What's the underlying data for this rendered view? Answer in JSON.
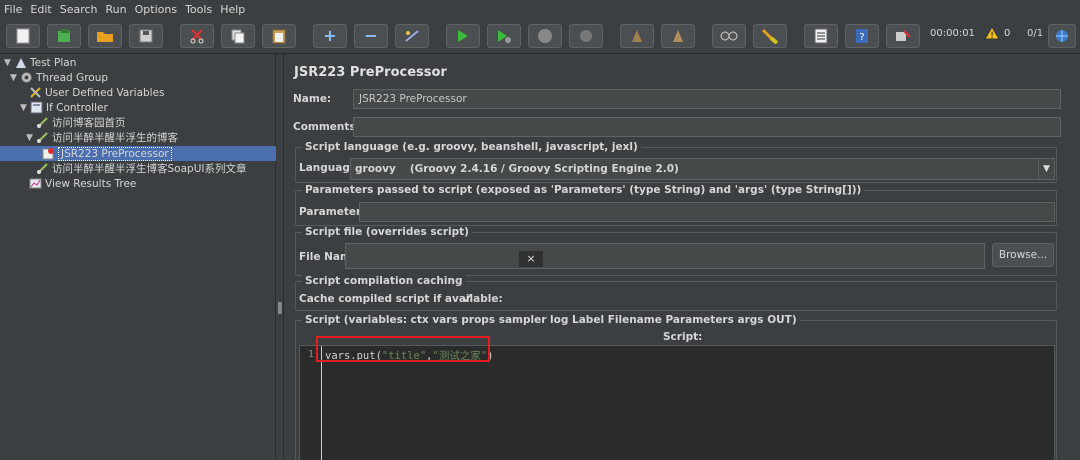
{
  "menu": [
    "File",
    "Edit",
    "Search",
    "Run",
    "Options",
    "Tools",
    "Help"
  ],
  "toolbar": {
    "timer": "00:00:01",
    "warnings": "0",
    "threads": "0/1"
  },
  "tree": [
    {
      "label": "Test Plan",
      "icon": "test-plan-icon"
    },
    {
      "label": "Thread Group",
      "icon": "gear-icon"
    },
    {
      "label": "User Defined Variables",
      "icon": "wrench-icon"
    },
    {
      "label": "If Controller",
      "icon": "controller-icon"
    },
    {
      "label": "访问博客园首页",
      "icon": "sampler-icon"
    },
    {
      "label": "访问半醉半醒半浮生的博客",
      "icon": "sampler-icon"
    },
    {
      "label": "JSR223 PreProcessor",
      "icon": "preprocessor-icon"
    },
    {
      "label": "访问半醉半醒半浮生博客SoapUI系列文章",
      "icon": "sampler-icon"
    },
    {
      "label": "View Results Tree",
      "icon": "chart-icon"
    }
  ],
  "panel": {
    "title": "JSR223 PreProcessor",
    "name_label": "Name:",
    "name_value": "JSR223 PreProcessor",
    "comments_label": "Comments:",
    "comments_value": "",
    "lang_group": "Script language (e.g. groovy, beanshell, javascript, jexl)",
    "lang_label": "Language:",
    "lang_value": "groovy",
    "lang_engine": "(Groovy 2.4.16 / Groovy Scripting Engine 2.0)",
    "params_group": "Parameters passed to script (exposed as 'Parameters' (type String) and 'args' (type String[]))",
    "params_label": "Parameters:",
    "params_value": "",
    "file_group": "Script file (overrides script)",
    "file_label": "File Name:",
    "file_value": "",
    "browse_label": "Browse...",
    "cache_group": "Script compilation caching",
    "cache_label": "Cache compiled script if available:",
    "script_group": "Script (variables: ctx vars props sampler log Label Filename Parameters args OUT)",
    "script_label": "Script:",
    "line_no": "1",
    "code_prefix": "vars.put(",
    "code_arg1": "\"title\"",
    "code_sep": ",",
    "code_arg2": "\"测试之家\"",
    "code_suffix": ")"
  }
}
